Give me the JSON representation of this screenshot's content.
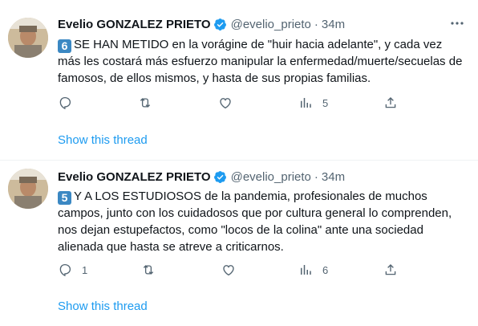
{
  "tweets": [
    {
      "author_name": "Evelio GONZALEZ PRIETO",
      "handle": "@evelio_prieto",
      "separator": "·",
      "time": "34m",
      "number_badge": "6",
      "text": "SE HAN METIDO en la vorágine de \"huir hacia adelante\", y cada vez más les costará más esfuerzo manipular la enfermedad/muerte/secuelas de famosos, de ellos mismos, y hasta de sus propias familias.",
      "reply_count": "",
      "retweet_count": "",
      "like_count": "",
      "views_count": "5",
      "show_thread": "Show this thread"
    },
    {
      "author_name": "Evelio GONZALEZ PRIETO",
      "handle": "@evelio_prieto",
      "separator": "·",
      "time": "34m",
      "number_badge": "5",
      "text": "Y A LOS ESTUDIOSOS de la pandemia, profesionales de muchos campos, junto con los cuidadosos que por cultura general lo comprenden, nos dejan estupefactos, como \"locos de la colina\" ante una sociedad alienada que hasta se atreve a criticarnos.",
      "reply_count": "1",
      "retweet_count": "",
      "like_count": "",
      "views_count": "6",
      "show_thread": "Show this thread"
    }
  ],
  "icons": {
    "verified": "verified-badge-icon",
    "more": "more-options-icon",
    "reply": "reply-icon",
    "retweet": "retweet-icon",
    "like": "like-icon",
    "views": "views-icon",
    "share": "share-icon"
  },
  "colors": {
    "link": "#1d9bf0",
    "verified": "#1d9bf0",
    "muted": "#536471",
    "number_badge": "#3b88c3"
  }
}
